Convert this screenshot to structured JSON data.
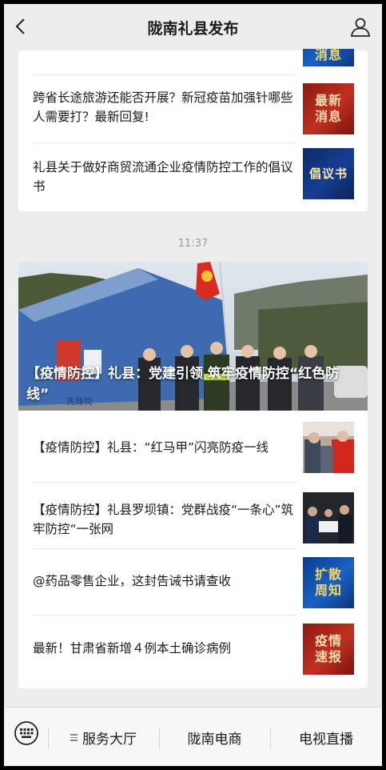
{
  "header": {
    "title": "陇南礼县发布"
  },
  "feed1": {
    "items": [
      {
        "text": "",
        "thumb": "消息"
      },
      {
        "text": "跨省长途旅游还能否开展？新冠疫苗加强针哪些人需要打？最新回复!",
        "thumb_line1": "最新",
        "thumb_line2": "消息"
      },
      {
        "text": "礼县关于做好商贸流通企业疫情防控工作的倡议书",
        "thumb": "倡议书"
      }
    ]
  },
  "timestamp": "11:37",
  "feed2": {
    "hero": {
      "caption": "【疫情防控】礼县：党建引领 筑牢疫情防控“红色防线”",
      "banner_text": "先锋岗"
    },
    "items": [
      {
        "text": "【疫情防控】礼县：“红马甲”闪亮防疫一线"
      },
      {
        "text": "【疫情防控】礼县罗坝镇：党群战疫“一条心”筑牢防控“一张网"
      },
      {
        "text": "@药品零售企业，这封告诫书请查收",
        "thumb_line1": "扩散",
        "thumb_line2": "周知"
      },
      {
        "text": "最新！甘肃省新增４例本土确诊病例",
        "thumb_line1": "疫情",
        "thumb_line2": "速报"
      }
    ]
  },
  "bottom_menu": {
    "item1": "服务大厅",
    "item2": "陇南电商",
    "item3": "电视直播"
  },
  "icons": [
    "back-icon",
    "profile-icon",
    "keyboard-icon",
    "menu-lines-icon"
  ],
  "colors": {
    "background": "#ededed",
    "thumb_red": "#b02a1c",
    "thumb_blue": "#163e92"
  }
}
